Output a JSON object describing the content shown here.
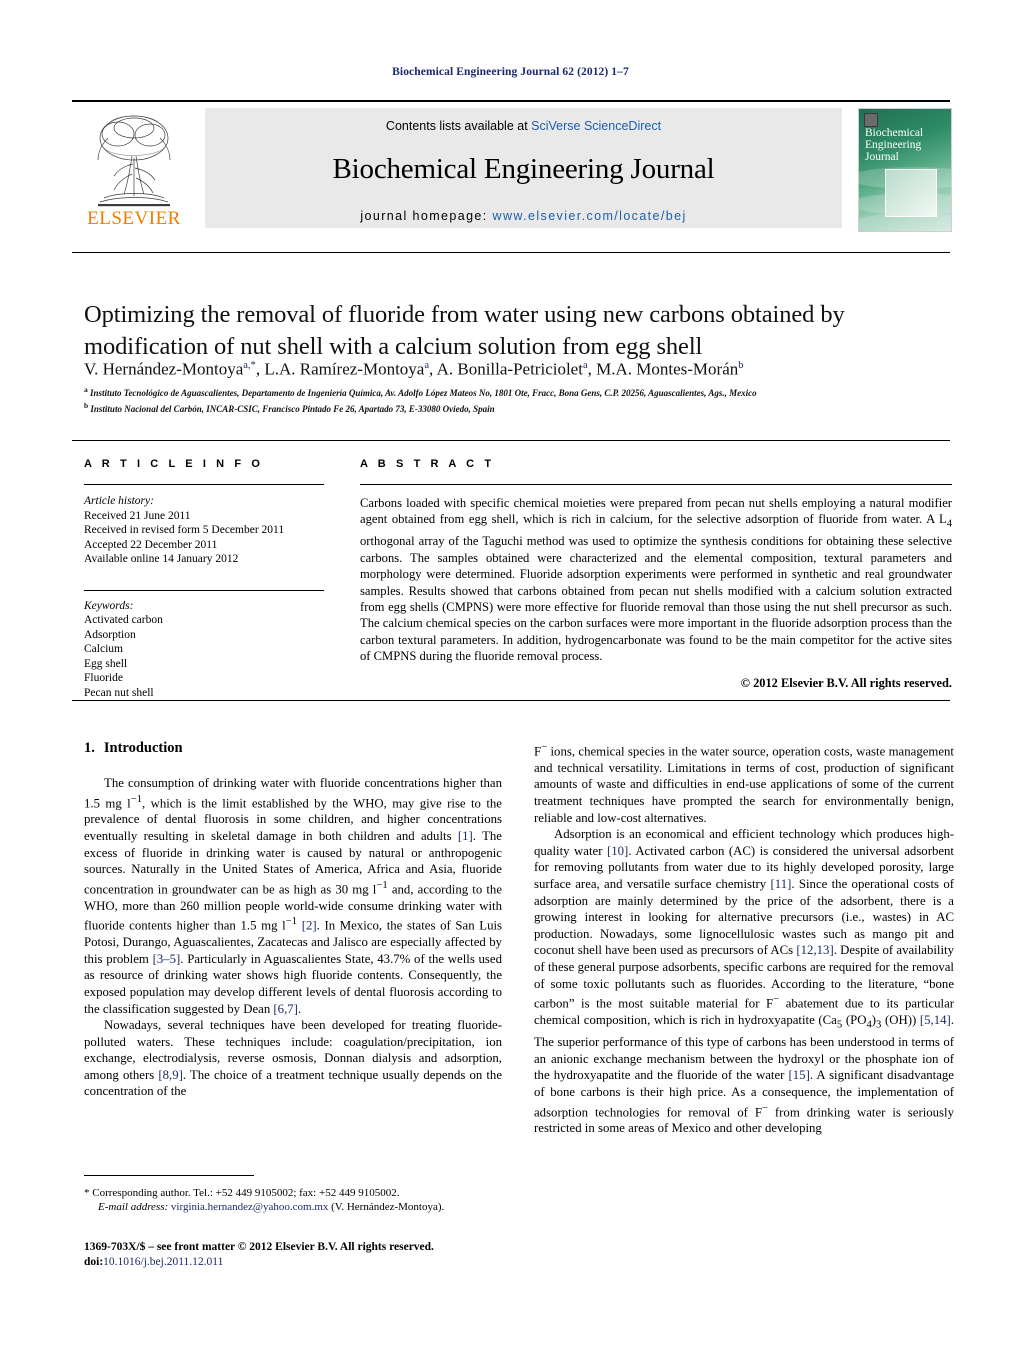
{
  "running_head": "Biochemical Engineering Journal 62 (2012) 1–7",
  "masthead": {
    "contents_prefix": "Contents lists available at ",
    "sciencedirect": "SciVerse ScienceDirect",
    "journal_title": "Biochemical Engineering Journal",
    "homepage_prefix": "journal homepage: ",
    "homepage_url": "www.elsevier.com/locate/bej",
    "publisher": "ELSEVIER",
    "cover_title": "Biochemical Engineering Journal",
    "accent_blue": "#1b5fae",
    "elsevier_orange": "#ef7d00",
    "box_gray": "#e9e9e9"
  },
  "article": {
    "title": "Optimizing the removal of fluoride from water using new carbons obtained by modification of nut shell with a calcium solution from egg shell",
    "authors_html": "V. Hernández-Montoya<sup>a,*</sup>, L.A. Ramírez-Montoya<sup>a</sup>, A. Bonilla-Petriciolet<sup>a</sup>, M.A. Montes-Morán<sup>b</sup>",
    "affiliation_a": "Instituto Tecnológico de Aguascalientes, Departamento de Ingeniería Química, Av. Adolfo López Mateos No, 1801 Ote, Fracc, Bona Gens, C.P. 20256, Aguascalientes, Ags., Mexico",
    "affiliation_b": "Instituto Nacional del Carbón, INCAR-CSIC, Francisco Pintado Fe 26, Apartado 73, E-33080 Oviedo, Spain"
  },
  "info": {
    "heading": "A R T I C L E    I N F O",
    "history_label": "Article history:",
    "history": [
      "Received 21 June 2011",
      "Received in revised form 5 December 2011",
      "Accepted 22 December 2011",
      "Available online 14 January 2012"
    ],
    "keywords_label": "Keywords:",
    "keywords": [
      "Activated carbon",
      "Adsorption",
      "Calcium",
      "Egg shell",
      "Fluoride",
      "Pecan nut shell"
    ]
  },
  "abstract": {
    "heading": "A B S T R A C T",
    "text": "Carbons loaded with specific chemical moieties were prepared from pecan nut shells employing a natural modifier agent obtained from egg shell, which is rich in calcium, for the selective adsorption of fluoride from water. A L4 orthogonal array of the Taguchi method was used to optimize the synthesis conditions for obtaining these selective carbons. The samples obtained were characterized and the elemental composition, textural parameters and morphology were determined. Fluoride adsorption experiments were performed in synthetic and real groundwater samples. Results showed that carbons obtained from pecan nut shells modified with a calcium solution extracted from egg shells (CMPNS) were more effective for fluoride removal than those using the nut shell precursor as such. The calcium chemical species on the carbon surfaces were more important in the fluoride adsorption process than the carbon textural parameters. In addition, hydrogencarbonate was found to be the main competitor for the active sites of CMPNS during the fluoride removal process.",
    "copyright": "© 2012 Elsevier B.V. All rights reserved."
  },
  "introduction": {
    "number": "1.",
    "heading": "Introduction",
    "left_paragraphs": [
      "The consumption of drinking water with fluoride concentrations higher than 1.5 mg l−1, which is the limit established by the WHO, may give rise to the prevalence of dental fluorosis in some children, and higher concentrations eventually resulting in skeletal damage in both children and adults [1]. The excess of fluoride in drinking water is caused by natural or anthropogenic sources. Naturally in the United States of America, Africa and Asia, fluoride concentration in groundwater can be as high as 30 mg l−1 and, according to the WHO, more than 260 million people world-wide consume drinking water with fluoride contents higher than 1.5 mg l−1 [2]. In Mexico, the states of San Luis Potosi, Durango, Aguascalientes, Zacatecas and Jalisco are especially affected by this problem [3–5]. Particularly in Aguascalientes State, 43.7% of the wells used as resource of drinking water shows high fluoride contents. Consequently, the exposed population may develop different levels of dental fluorosis according to the classification suggested by Dean [6,7].",
      "Nowadays, several techniques have been developed for treating fluoride-polluted waters. These techniques include: coagulation/precipitation, ion exchange, electrodialysis, reverse osmosis, Donnan dialysis and adsorption, among others [8,9]. The choice of a treatment technique usually depends on the concentration of the"
    ],
    "right_paragraphs": [
      "F− ions, chemical species in the water source, operation costs, waste management and technical versatility. Limitations in terms of cost, production of significant amounts of waste and difficulties in end-use applications of some of the current treatment techniques have prompted the search for environmentally benign, reliable and low-cost alternatives.",
      "Adsorption is an economical and efficient technology which produces high-quality water [10]. Activated carbon (AC) is considered the universal adsorbent for removing pollutants from water due to its highly developed porosity, large surface area, and versatile surface chemistry [11]. Since the operational costs of adsorption are mainly determined by the price of the adsorbent, there is a growing interest in looking for alternative precursors (i.e., wastes) in AC production. Nowadays, some lignocellulosic wastes such as mango pit and coconut shell have been used as precursors of ACs [12,13]. Despite of availability of these general purpose adsorbents, specific carbons are required for the removal of some toxic pollutants such as fluorides. According to the literature, \"bone carbon\" is the most suitable material for F− abatement due to its particular chemical composition, which is rich in hydroxyapatite (Ca5 (PO4)3 (OH)) [5,14]. The superior performance of this type of carbons has been understood in terms of an anionic exchange mechanism between the hydroxyl or the phosphate ion of the hydroxyapatite and the fluoride of the water [15]. A significant disadvantage of bone carbons is their high price. As a consequence, the implementation of adsorption technologies for removal of F− from drinking water is seriously restricted in some areas of Mexico and other developing"
    ]
  },
  "footnotes": {
    "corresponding": "* Corresponding author. Tel.: +52 449 9105002; fax: +52 449 9105002.",
    "email_label": "E-mail address:",
    "email": "virginia.hernandez@yahoo.com.mx",
    "email_author": "(V. Hernández-Montoya).",
    "issn_line": "1369-703X/$ – see front matter © 2012 Elsevier B.V. All rights reserved.",
    "doi_label": "doi:",
    "doi": "10.1016/j.bej.2011.12.011"
  }
}
